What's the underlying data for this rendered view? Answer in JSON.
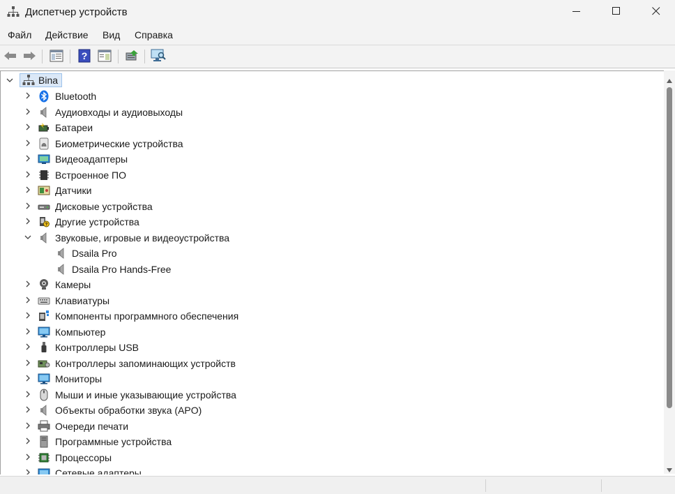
{
  "window": {
    "title": "Диспетчер устройств",
    "controls": [
      "minimize",
      "maximize",
      "close"
    ]
  },
  "menu": [
    "Файл",
    "Действие",
    "Вид",
    "Справка"
  ],
  "toolbar": [
    "back-icon",
    "forward-icon",
    "properties-view-icon",
    "help-icon",
    "panel-view-icon",
    "update-driver-icon",
    "scan-hardware-icon"
  ],
  "tree": {
    "root": {
      "label": "Bina",
      "expanded": true,
      "selected": true
    },
    "categories": [
      {
        "label": "Bluetooth",
        "icon": "bluetooth-icon",
        "expanded": false
      },
      {
        "label": "Аудиовходы и аудиовыходы",
        "icon": "speaker-icon",
        "expanded": false
      },
      {
        "label": "Батареи",
        "icon": "battery-icon",
        "expanded": false
      },
      {
        "label": "Биометрические устройства",
        "icon": "fingerprint-icon",
        "expanded": false
      },
      {
        "label": "Видеоадаптеры",
        "icon": "display-adapter-icon",
        "expanded": false
      },
      {
        "label": "Встроенное ПО",
        "icon": "firmware-chip-icon",
        "expanded": false
      },
      {
        "label": "Датчики",
        "icon": "sensor-icon",
        "expanded": false
      },
      {
        "label": "Дисковые устройства",
        "icon": "disk-drive-icon",
        "expanded": false
      },
      {
        "label": "Другие устройства",
        "icon": "unknown-device-icon",
        "expanded": false
      },
      {
        "label": "Звуковые, игровые и видеоустройства",
        "icon": "speaker-icon",
        "expanded": true,
        "children": [
          {
            "label": "Dsaila Pro",
            "icon": "speaker-icon"
          },
          {
            "label": "Dsaila Pro Hands-Free",
            "icon": "speaker-icon"
          }
        ]
      },
      {
        "label": "Камеры",
        "icon": "webcam-icon",
        "expanded": false
      },
      {
        "label": "Клавиатуры",
        "icon": "keyboard-icon",
        "expanded": false
      },
      {
        "label": "Компоненты программного обеспечения",
        "icon": "software-component-icon",
        "expanded": false
      },
      {
        "label": "Компьютер",
        "icon": "computer-monitor-icon",
        "expanded": false
      },
      {
        "label": "Контроллеры USB",
        "icon": "usb-icon",
        "expanded": false
      },
      {
        "label": "Контроллеры запоминающих устройств",
        "icon": "storage-controller-icon",
        "expanded": false
      },
      {
        "label": "Мониторы",
        "icon": "monitor-icon",
        "expanded": false
      },
      {
        "label": "Мыши и иные указывающие устройства",
        "icon": "mouse-icon",
        "expanded": false
      },
      {
        "label": "Объекты обработки звука (APO)",
        "icon": "speaker-icon",
        "expanded": false
      },
      {
        "label": "Очереди печати",
        "icon": "printer-icon",
        "expanded": false
      },
      {
        "label": "Программные устройства",
        "icon": "software-device-icon",
        "expanded": false
      },
      {
        "label": "Процессоры",
        "icon": "processor-icon",
        "expanded": false
      },
      {
        "label": "Сетевые адаптеры",
        "icon": "network-adapter-icon",
        "expanded": false
      }
    ]
  },
  "colors": {
    "selection_bg": "#dbe8f7",
    "selection_border": "#9ec3eb",
    "chrome_bg": "#f3f3f3"
  }
}
